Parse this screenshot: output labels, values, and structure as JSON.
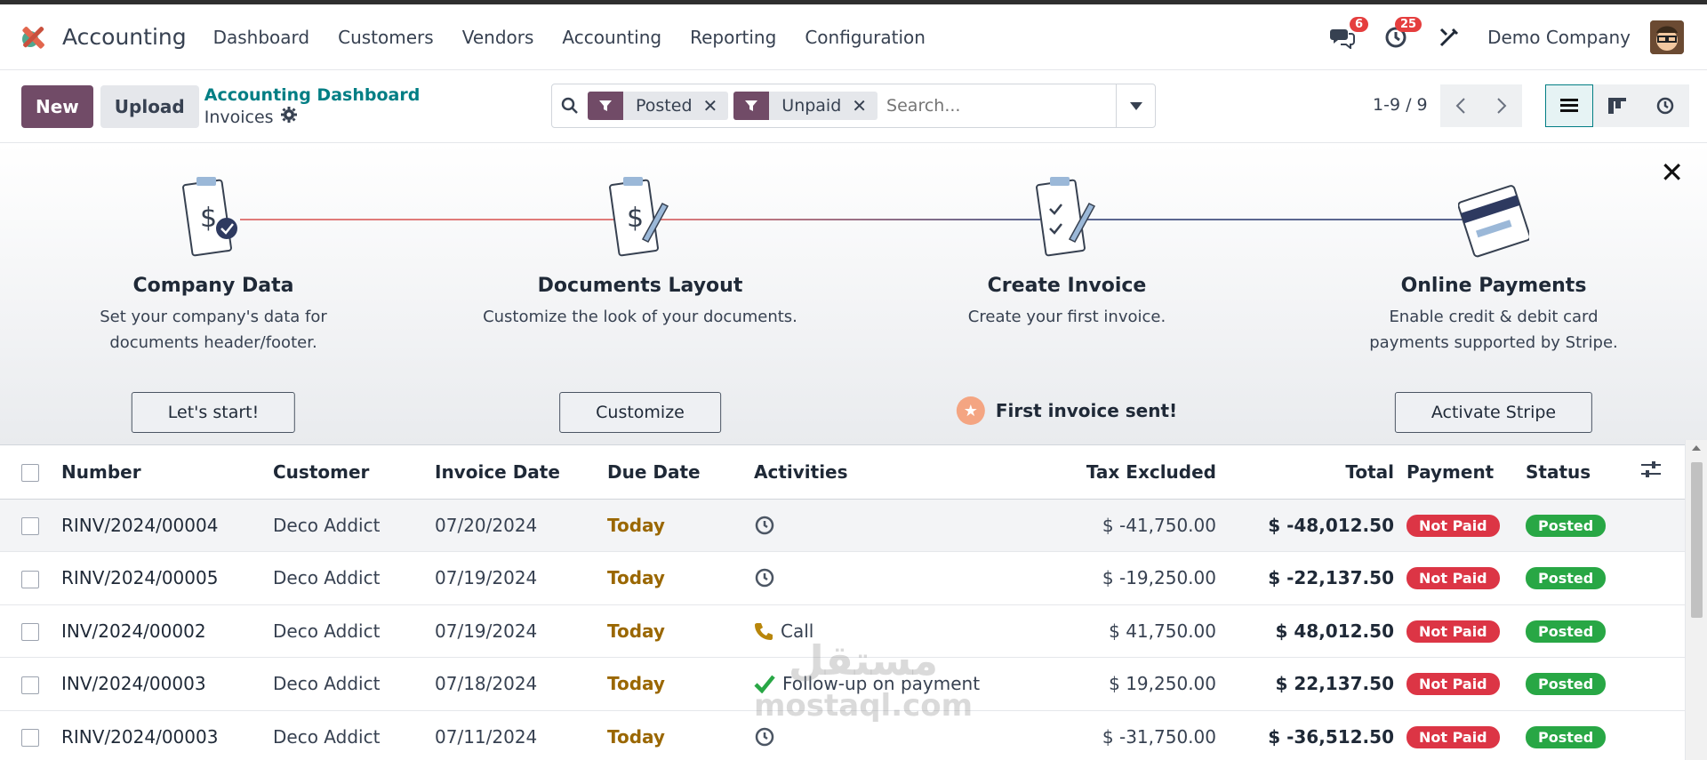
{
  "app": {
    "name": "Accounting",
    "logo_icon": "accounting-logo"
  },
  "menu": [
    "Dashboard",
    "Customers",
    "Vendors",
    "Accounting",
    "Reporting",
    "Configuration"
  ],
  "systray": {
    "messages_count": "6",
    "activities_count": "25",
    "company": "Demo Company"
  },
  "control": {
    "new_label": "New",
    "upload_label": "Upload",
    "breadcrumb_parent": "Accounting Dashboard",
    "breadcrumb_current": "Invoices",
    "facets": [
      "Posted",
      "Unpaid"
    ],
    "search_placeholder": "Search...",
    "pager": "1-9 / 9"
  },
  "onboarding": {
    "steps": [
      {
        "title": "Company Data",
        "desc": "Set your company's data for documents header/footer.",
        "button": "Let's start!"
      },
      {
        "title": "Documents Layout",
        "desc": "Customize the look of your documents.",
        "button": "Customize"
      },
      {
        "title": "Create Invoice",
        "desc": "Create your first invoice.",
        "done": "First invoice sent!"
      },
      {
        "title": "Online Payments",
        "desc": "Enable credit & debit card payments supported by Stripe.",
        "button": "Activate Stripe"
      }
    ]
  },
  "table": {
    "headers": [
      "Number",
      "Customer",
      "Invoice Date",
      "Due Date",
      "Activities",
      "Tax Excluded",
      "Total",
      "Payment",
      "Status"
    ],
    "rows": [
      {
        "number": "RINV/2024/00004",
        "customer": "Deco Addict",
        "invoice_date": "07/20/2024",
        "due": "Today",
        "activity": "",
        "activity_icon": "clock-icon",
        "tax_excluded": "$ -41,750.00",
        "total": "$ -48,012.50",
        "payment": "Not Paid",
        "status": "Posted"
      },
      {
        "number": "RINV/2024/00005",
        "customer": "Deco Addict",
        "invoice_date": "07/19/2024",
        "due": "Today",
        "activity": "",
        "activity_icon": "clock-icon",
        "tax_excluded": "$ -19,250.00",
        "total": "$ -22,137.50",
        "payment": "Not Paid",
        "status": "Posted"
      },
      {
        "number": "INV/2024/00002",
        "customer": "Deco Addict",
        "invoice_date": "07/19/2024",
        "due": "Today",
        "activity": "Call",
        "activity_icon": "phone-icon",
        "tax_excluded": "$ 41,750.00",
        "total": "$ 48,012.50",
        "payment": "Not Paid",
        "status": "Posted"
      },
      {
        "number": "INV/2024/00003",
        "customer": "Deco Addict",
        "invoice_date": "07/18/2024",
        "due": "Today",
        "activity": "Follow-up on payment",
        "activity_icon": "check-icon",
        "tax_excluded": "$ 19,250.00",
        "total": "$ 22,137.50",
        "payment": "Not Paid",
        "status": "Posted"
      },
      {
        "number": "RINV/2024/00003",
        "customer": "Deco Addict",
        "invoice_date": "07/11/2024",
        "due": "Today",
        "activity": "",
        "activity_icon": "clock-icon",
        "tax_excluded": "$ -31,750.00",
        "total": "$ -36,512.50",
        "payment": "Not Paid",
        "status": "Posted"
      }
    ]
  },
  "watermark": "mostaql.com",
  "colors": {
    "brand": "#714b67",
    "link": "#017e84",
    "not_paid": "#dc3545",
    "posted": "#28a745",
    "due_today": "#9a6700"
  }
}
